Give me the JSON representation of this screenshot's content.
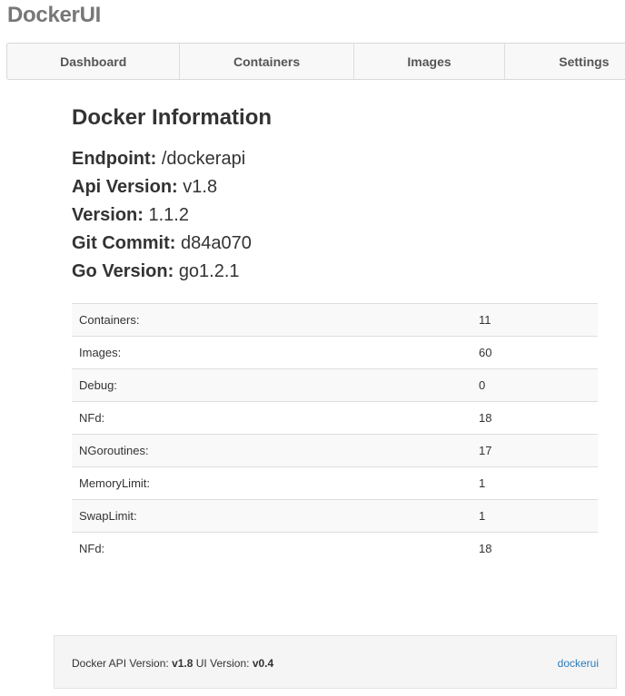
{
  "app": {
    "brand": "DockerUI"
  },
  "nav": {
    "tabs": [
      {
        "label": "Dashboard"
      },
      {
        "label": "Containers"
      },
      {
        "label": "Images"
      },
      {
        "label": "Settings"
      }
    ]
  },
  "main": {
    "title": "Docker Information",
    "info": [
      {
        "key": "Endpoint:",
        "value": "/dockerapi"
      },
      {
        "key": "Api Version:",
        "value": "v1.8"
      },
      {
        "key": "Version:",
        "value": "1.1.2"
      },
      {
        "key": "Git Commit:",
        "value": "d84a070"
      },
      {
        "key": "Go Version:",
        "value": "go1.2.1"
      }
    ],
    "stats": [
      {
        "label": "Containers:",
        "value": "11"
      },
      {
        "label": "Images:",
        "value": "60"
      },
      {
        "label": "Debug:",
        "value": "0"
      },
      {
        "label": "NFd:",
        "value": "18"
      },
      {
        "label": "NGoroutines:",
        "value": "17"
      },
      {
        "label": "MemoryLimit:",
        "value": "1"
      },
      {
        "label": "SwapLimit:",
        "value": "1"
      },
      {
        "label": "NFd:",
        "value": "18"
      }
    ]
  },
  "footer": {
    "api_label": "Docker API Version:",
    "api_version": "v1.8",
    "ui_label": "UI Version:",
    "ui_version": "v0.4",
    "link": "dockerui"
  }
}
